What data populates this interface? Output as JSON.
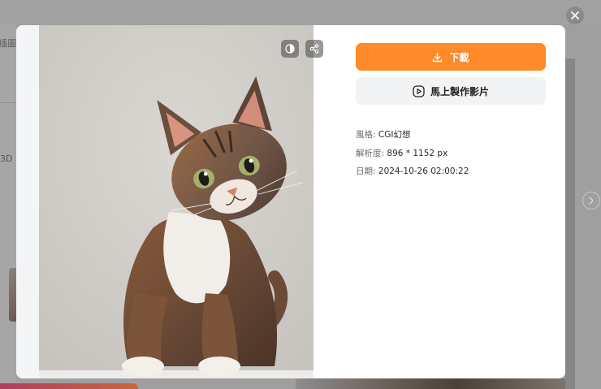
{
  "background": {
    "tab_text_top": "插圖",
    "side_text_3d": "3D"
  },
  "modal": {
    "download_label": "下載",
    "make_video_label": "馬上製作影片",
    "details": [
      {
        "label": "風格:",
        "value": "CGI幻想"
      },
      {
        "label": "解析度:",
        "value": "896 * 1152 px"
      },
      {
        "label": "日期:",
        "value": "2024-10-26 02:00:22"
      }
    ]
  },
  "icons": {
    "close": "close-icon",
    "compare": "compare-icon",
    "share": "share-icon",
    "download": "download-icon",
    "video": "play-circle-icon",
    "next": "chevron-right-icon"
  },
  "colors": {
    "accent": "#ff8a29",
    "secondary_button": "#f2f3f5",
    "overlay": "#9c9c9c"
  }
}
